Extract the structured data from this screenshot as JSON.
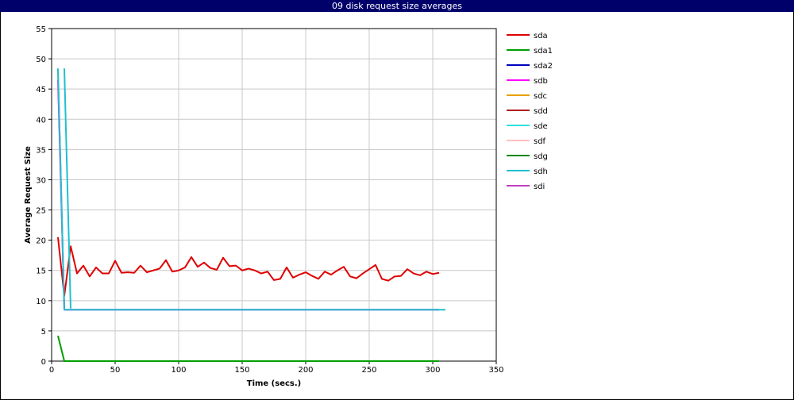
{
  "window": {
    "title": "09 disk request size averages"
  },
  "colors": {
    "titlebar": "#00006b",
    "grid": "#c8c8c8",
    "frame": "#000000"
  },
  "chart_data": {
    "type": "line",
    "title": "09 disk request size averages",
    "xlabel": "Time (secs.)",
    "ylabel": "Average Request Size",
    "xlim": [
      0,
      350
    ],
    "ylim": [
      0,
      55
    ],
    "xticks": [
      0,
      50,
      100,
      150,
      200,
      250,
      300,
      350
    ],
    "yticks": [
      0,
      5,
      10,
      15,
      20,
      25,
      30,
      35,
      40,
      45,
      50,
      55
    ],
    "grid": true,
    "legend_position": "right",
    "series": [
      {
        "name": "sda",
        "color": "#e00000",
        "x": [
          5,
          10,
          15,
          20,
          25,
          30,
          35,
          40,
          45,
          50,
          55,
          60,
          65,
          70,
          75,
          80,
          85,
          90,
          95,
          100,
          105,
          110,
          115,
          120,
          125,
          130,
          135,
          140,
          145,
          150,
          155,
          160,
          165,
          170,
          175,
          180,
          185,
          190,
          195,
          200,
          205,
          210,
          215,
          220,
          225,
          230,
          235,
          240,
          245,
          250,
          255,
          260,
          265,
          270,
          275,
          280,
          285,
          290,
          295,
          300,
          305
        ],
        "y": [
          20.5,
          10.8,
          19,
          14.5,
          15.8,
          14,
          15.5,
          14.5,
          14.5,
          16.6,
          14.6,
          14.7,
          14.6,
          15.8,
          14.7,
          15,
          15.3,
          16.7,
          14.8,
          15,
          15.5,
          17.2,
          15.6,
          16.3,
          15.4,
          15.1,
          17.1,
          15.7,
          15.8,
          15,
          15.3,
          15,
          14.5,
          14.8,
          13.4,
          13.6,
          15.5,
          13.8,
          14.3,
          14.7,
          14.1,
          13.6,
          14.8,
          14.3,
          15,
          15.6,
          14,
          13.7,
          14.5,
          15.2,
          15.9,
          13.6,
          13.3,
          14,
          14.1,
          15.2,
          14.5,
          14.2,
          14.8,
          14.4,
          14.6
        ]
      },
      {
        "name": "sda1",
        "color": "#00a000",
        "x": [
          5,
          10,
          305
        ],
        "y": [
          4.2,
          0,
          0
        ]
      },
      {
        "name": "sda2",
        "color": "#0000c0",
        "x": [],
        "y": []
      },
      {
        "name": "sdb",
        "color": "#ff00ff",
        "x": [
          5,
          10,
          305
        ],
        "y": [
          46.5,
          8.5,
          8.5
        ]
      },
      {
        "name": "sdc",
        "color": "#e8a000",
        "x": [
          5,
          10
        ],
        "y": [
          48.3,
          8.5
        ]
      },
      {
        "name": "sdd",
        "color": "#b02020",
        "x": [],
        "y": []
      },
      {
        "name": "sde",
        "color": "#30e0e0",
        "x": [],
        "y": []
      },
      {
        "name": "sdf",
        "color": "#ffc0c0",
        "x": [],
        "y": []
      },
      {
        "name": "sdg",
        "color": "#008800",
        "x": [],
        "y": []
      },
      {
        "name": "sdh",
        "color": "#20c0d0",
        "x": [
          5,
          10,
          15,
          305,
          310
        ],
        "y": [
          48.4,
          8.5,
          8.5,
          8.5,
          8.5
        ]
      },
      {
        "name": "sdi",
        "color": "#c040c0",
        "x": [],
        "y": []
      }
    ],
    "extra_segments": [
      {
        "series": "sdh",
        "x": [
          10,
          15
        ],
        "y": [
          48.4,
          8.7
        ]
      }
    ]
  }
}
